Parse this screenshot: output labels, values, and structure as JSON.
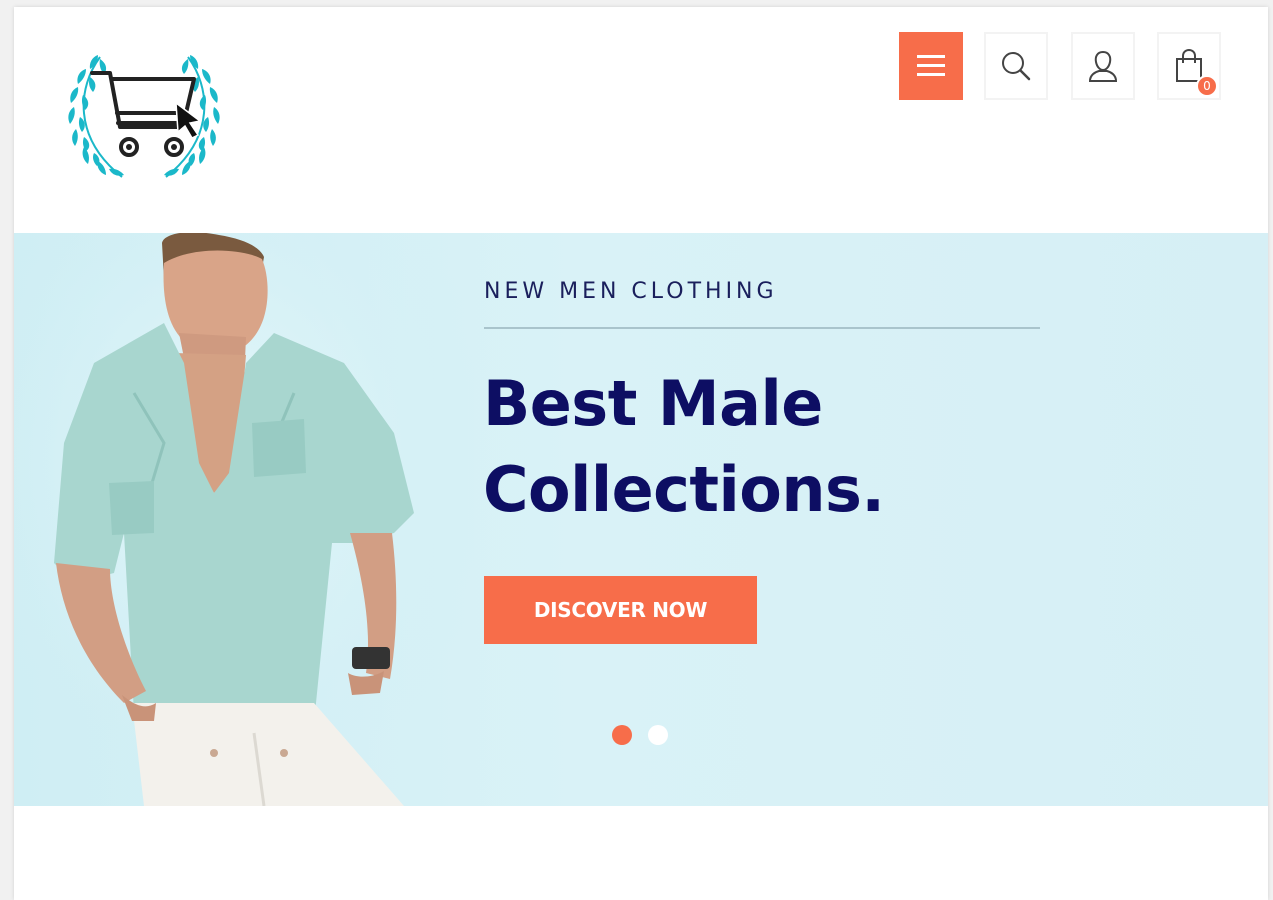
{
  "header": {
    "logo_icon": "cart-laurel-logo",
    "buttons": [
      {
        "name": "menu",
        "icon": "hamburger-icon"
      },
      {
        "name": "search",
        "icon": "search-icon"
      },
      {
        "name": "account",
        "icon": "user-icon"
      },
      {
        "name": "cart",
        "icon": "shopping-bag-icon",
        "count": "0"
      }
    ]
  },
  "hero": {
    "eyebrow": "NEW MEN CLOTHING",
    "headline_line1": "Best Male",
    "headline_line2": "Collections.",
    "cta_label": "DISCOVER NOW",
    "slides_total": 2,
    "active_slide": 1
  },
  "colors": {
    "accent": "#f76d4a",
    "headline": "#0d0e63",
    "hero_bg": "#d6eff5",
    "logo_laurel": "#1bb8c9"
  }
}
